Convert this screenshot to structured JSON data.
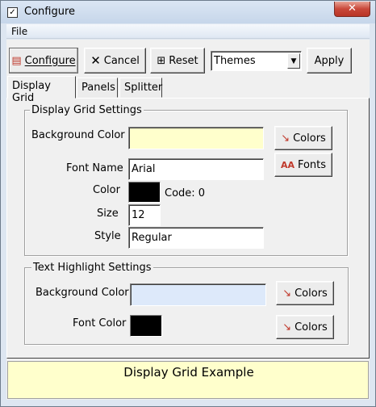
{
  "window": {
    "title": "Configure",
    "close_glyph": "✕"
  },
  "menu": {
    "file": "File"
  },
  "toolbar": {
    "configure": "Configure",
    "cancel": "Cancel",
    "reset": "Reset",
    "themes_value": "Themes",
    "apply": "Apply"
  },
  "tabs": [
    "Display Grid",
    "Panels",
    "Splitter"
  ],
  "display_grid_settings": {
    "title": "Display Grid Settings",
    "background_color_label": "Background Color",
    "background_color": "#ffffcc",
    "colors_button": "Colors",
    "font_name_label": "Font Name",
    "font_name": "Arial",
    "fonts_button": "Fonts",
    "color_label": "Color",
    "font_color": "#000000",
    "code_text": "Code: 0",
    "size_label": "Size",
    "size": "12",
    "style_label": "Style",
    "style": "Regular"
  },
  "text_highlight_settings": {
    "title": "Text Highlight Settings",
    "background_color_label": "Background Color",
    "background_color": "#dde9fa",
    "colors_button": "Colors",
    "font_color_label": "Font Color",
    "font_color": "#000000",
    "colors_button_2": "Colors"
  },
  "example": {
    "text": "Display Grid Example",
    "background": "#ffffcc"
  },
  "icons": {
    "window": "checkbox-icon",
    "configure": "configure-icon",
    "cancel": "x-icon",
    "reset": "reset-icon",
    "colors": "color-picker-icon",
    "fonts": "fonts-icon"
  }
}
